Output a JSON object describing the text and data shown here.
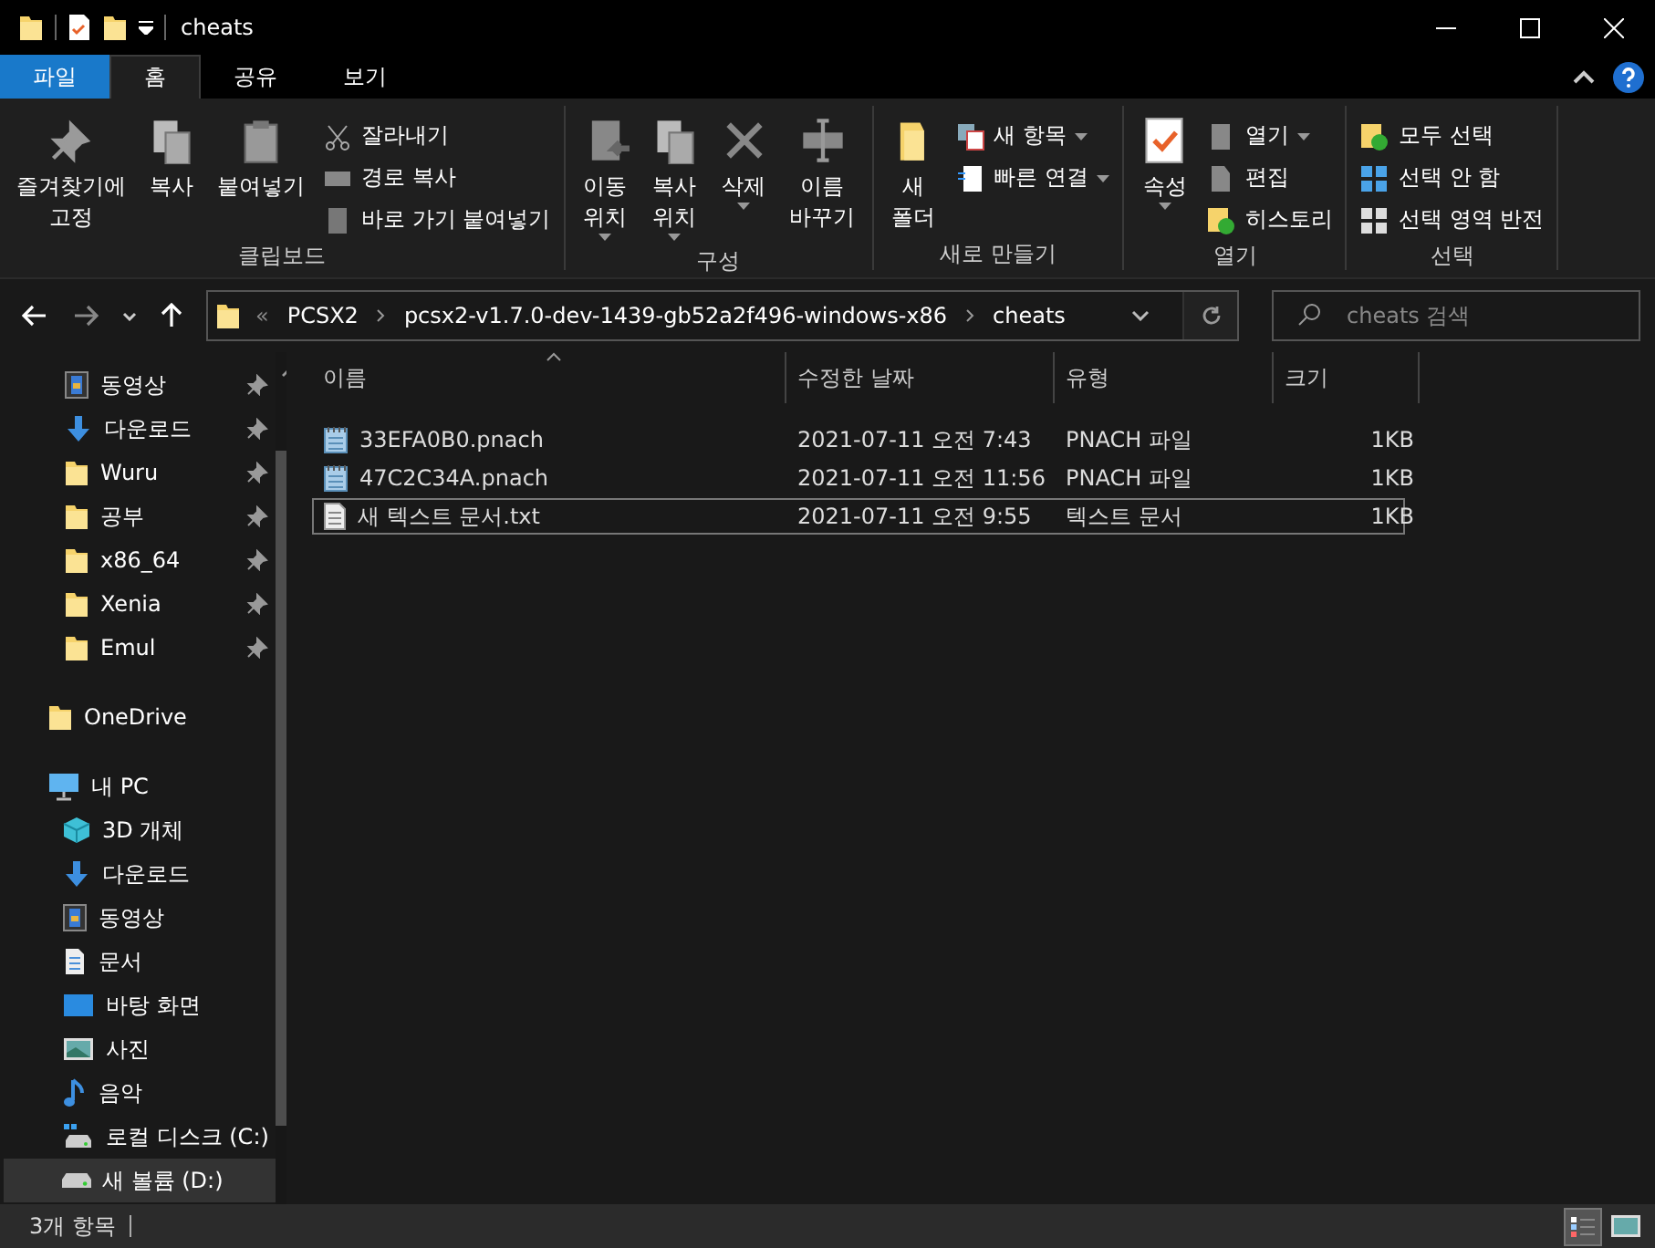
{
  "window": {
    "title": "cheats"
  },
  "ribbon": {
    "tabs": [
      {
        "label": "파일",
        "kind": "file",
        "selected": false
      },
      {
        "label": "홈",
        "kind": "tab",
        "selected": true
      },
      {
        "label": "공유",
        "kind": "tab",
        "selected": false
      },
      {
        "label": "보기",
        "kind": "tab",
        "selected": false
      }
    ],
    "groups": [
      {
        "label": "클립보드",
        "items": [
          {
            "label": "즐겨찾기에\n고정",
            "kind": "large",
            "dropdown": false
          },
          {
            "label": "복사",
            "kind": "large",
            "dropdown": false
          },
          {
            "label": "붙여넣기",
            "kind": "large",
            "dropdown": false
          },
          {
            "label": "잘라내기",
            "kind": "small",
            "dropdown": false
          },
          {
            "label": "경로 복사",
            "kind": "small",
            "dropdown": false
          },
          {
            "label": "바로 가기 붙여넣기",
            "kind": "small",
            "dropdown": false
          }
        ]
      },
      {
        "label": "구성",
        "items": [
          {
            "label": "이동\n위치",
            "kind": "large",
            "dropdown": true
          },
          {
            "label": "복사\n위치",
            "kind": "large",
            "dropdown": true
          },
          {
            "label": "삭제",
            "kind": "large",
            "dropdown": true
          },
          {
            "label": "이름\n바꾸기",
            "kind": "large",
            "dropdown": false
          }
        ]
      },
      {
        "label": "새로 만들기",
        "items": [
          {
            "label": "새\n폴더",
            "kind": "large",
            "dropdown": false
          },
          {
            "label": "새 항목",
            "kind": "small",
            "dropdown": true
          },
          {
            "label": "빠른 연결",
            "kind": "small",
            "dropdown": true
          }
        ]
      },
      {
        "label": "열기",
        "items": [
          {
            "label": "속성",
            "kind": "large",
            "dropdown": true
          },
          {
            "label": "열기",
            "kind": "small",
            "dropdown": true
          },
          {
            "label": "편집",
            "kind": "small",
            "dropdown": false
          },
          {
            "label": "히스토리",
            "kind": "small",
            "dropdown": false
          }
        ]
      },
      {
        "label": "선택",
        "items": [
          {
            "label": "모두 선택",
            "kind": "small",
            "dropdown": false
          },
          {
            "label": "선택 안 함",
            "kind": "small",
            "dropdown": false
          },
          {
            "label": "선택 영역 반전",
            "kind": "small",
            "dropdown": false
          }
        ]
      }
    ]
  },
  "address": {
    "overflow": "«",
    "crumbs": [
      "PCSX2",
      "pcsx2-v1.7.0-dev-1439-gb52a2f496-windows-x86",
      "cheats"
    ]
  },
  "search": {
    "placeholder": "cheats 검색"
  },
  "nav": {
    "pinned": [
      {
        "label": "동영상",
        "pinned": true,
        "selected": false
      },
      {
        "label": "다운로드",
        "pinned": true,
        "selected": false
      },
      {
        "label": "Wuru",
        "pinned": true,
        "selected": false
      },
      {
        "label": "공부",
        "pinned": true,
        "selected": false
      },
      {
        "label": "x86_64",
        "pinned": true,
        "selected": false
      },
      {
        "label": "Xenia",
        "pinned": true,
        "selected": false
      },
      {
        "label": "Emul",
        "pinned": true,
        "selected": false
      }
    ],
    "tree": [
      {
        "label": "OneDrive",
        "selected": false
      },
      {
        "label": "내 PC",
        "selected": false,
        "children": [
          {
            "label": "3D 개체",
            "selected": false
          },
          {
            "label": "다운로드",
            "selected": false
          },
          {
            "label": "동영상",
            "selected": false
          },
          {
            "label": "문서",
            "selected": false
          },
          {
            "label": "바탕 화면",
            "selected": false
          },
          {
            "label": "사진",
            "selected": false
          },
          {
            "label": "음악",
            "selected": false
          },
          {
            "label": "로컬 디스크 (C:)",
            "selected": false
          },
          {
            "label": "새 볼륨 (D:)",
            "selected": true
          }
        ]
      }
    ]
  },
  "table": {
    "columns": [
      "이름",
      "수정한 날짜",
      "유형",
      "크기"
    ],
    "rows": [
      {
        "name": "33EFA0B0.pnach",
        "modified": "2021-07-11 오전 7:43",
        "type": "PNACH 파일",
        "size": "1KB",
        "kind": "pnach",
        "focused": false
      },
      {
        "name": "47C2C34A.pnach",
        "modified": "2021-07-11 오전 11:56",
        "type": "PNACH 파일",
        "size": "1KB",
        "kind": "pnach",
        "focused": false
      },
      {
        "name": "새 텍스트 문서.txt",
        "modified": "2021-07-11 오전 9:55",
        "type": "텍스트 문서",
        "size": "1KB",
        "kind": "text",
        "focused": true
      }
    ]
  },
  "status_bar": {
    "count": "3개 항목",
    "views": [
      {
        "selected": true
      },
      {
        "selected": false
      }
    ]
  }
}
